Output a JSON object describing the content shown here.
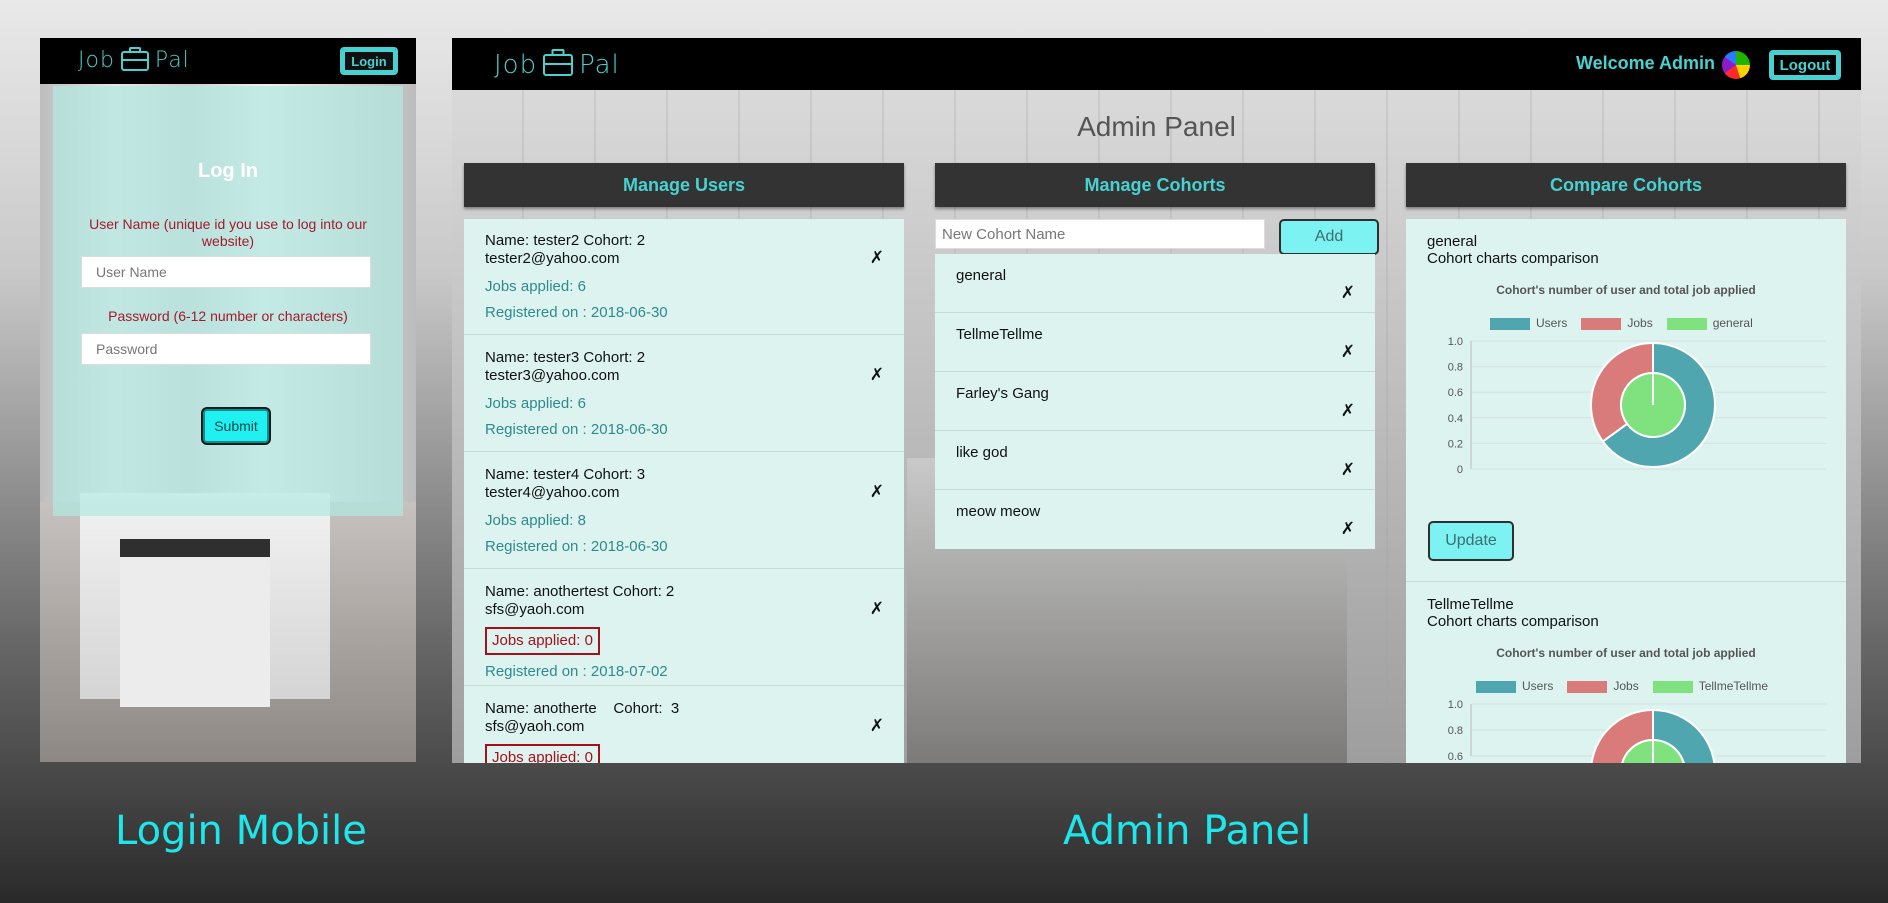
{
  "mobile": {
    "logo": "Job Pal",
    "login_button": "Login",
    "title": "Log In",
    "username_label": "User Name (unique id you use to log into our website)",
    "username_placeholder": "User Name",
    "password_label": "Password (6-12 number or characters)",
    "password_placeholder": "Password",
    "submit": "Submit"
  },
  "admin": {
    "logo": "Job Pal",
    "welcome": "Welcome Admin",
    "logout": "Logout",
    "title": "Admin Panel",
    "columns": {
      "users": "Manage Users",
      "cohorts": "Manage Cohorts",
      "compare": "Compare Cohorts"
    },
    "users": [
      {
        "name": "Name: tester2 Cohort: 2",
        "email": "tester2@yahoo.com",
        "jobs": "Jobs applied: 6",
        "registered": "Registered on : 2018-06-30"
      },
      {
        "name": "Name: tester3 Cohort: 2",
        "email": "tester3@yahoo.com",
        "jobs": "Jobs applied: 6",
        "registered": "Registered on : 2018-06-30"
      },
      {
        "name": "Name: tester4 Cohort: 3",
        "email": "tester4@yahoo.com",
        "jobs": "Jobs applied: 8",
        "registered": "Registered on : 2018-06-30"
      },
      {
        "name": "Name: anothertest Cohort: 2",
        "email": "sfs@yaoh.com",
        "jobs": "Jobs applied: 0",
        "registered": "Registered on : 2018-07-02"
      },
      {
        "name": "Name: anotherte    Cohort:  3",
        "email": "sfs@yaoh.com",
        "jobs": "Jobs applied: 0",
        "registered": ""
      }
    ],
    "delete_glyph": "✗",
    "cohort_input_placeholder": "New Cohort Name",
    "add_button": "Add",
    "cohorts": [
      "general",
      "TellmeTellme",
      "Farley's Gang",
      "like god",
      "meow meow"
    ],
    "compare": {
      "update_button": "Update",
      "subtitle": "Cohort charts comparison",
      "chart_title": "Cohort's number of user and total job applied"
    }
  },
  "captions": {
    "left": "Login Mobile",
    "right": "Admin Panel"
  },
  "colors": {
    "accent": "#48d1d1",
    "users": "#4fa6af",
    "jobs": "#d97b7b",
    "cohort": "#7fe27f"
  },
  "chart_data": [
    {
      "type": "pie",
      "title": "Cohort's number of user and total job applied",
      "legend": [
        "Users",
        "Jobs",
        "general"
      ],
      "yticks": [
        0,
        0.2,
        0.4,
        0.6,
        0.8,
        1.0
      ],
      "rings": [
        {
          "name": "outer",
          "slices": [
            {
              "label": "Users",
              "value": 0.65
            },
            {
              "label": "Jobs",
              "value": 0.35
            }
          ]
        },
        {
          "name": "inner",
          "slices": [
            {
              "label": "general",
              "value": 1.0
            }
          ]
        }
      ]
    },
    {
      "type": "pie",
      "title": "Cohort's number of user and total job applied",
      "legend": [
        "Users",
        "Jobs",
        "TellmeTellme"
      ],
      "yticks": [
        0.6,
        0.8,
        1.0
      ],
      "rings": [
        {
          "name": "outer",
          "slices": [
            {
              "label": "Users",
              "value": 0.28
            },
            {
              "label": "Jobs",
              "value": 0.72
            }
          ]
        },
        {
          "name": "inner",
          "slices": [
            {
              "label": "TellmeTellme",
              "value": 1.0
            }
          ]
        }
      ]
    }
  ]
}
